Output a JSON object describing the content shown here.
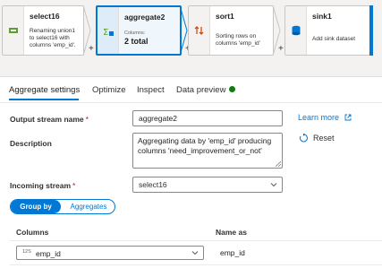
{
  "pipeline": {
    "nodes": [
      {
        "title": "select16",
        "description": "Renaming union1 to select16 with columns 'emp_id'."
      },
      {
        "title": "aggregate2",
        "sub_label": "Columns:",
        "big_value": "2 total"
      },
      {
        "title": "sort1",
        "description": "Sorting rows on columns 'emp_id'"
      },
      {
        "title": "sink1",
        "description": "Add sink dataset"
      }
    ],
    "add_symbol": "+"
  },
  "tabs": [
    "Aggregate settings",
    "Optimize",
    "Inspect",
    "Data preview"
  ],
  "active_tab": "Aggregate settings",
  "form": {
    "output_stream": {
      "label": "Output stream name",
      "required_mark": "*",
      "value": "aggregate2"
    },
    "description": {
      "label": "Description",
      "value": "Aggregating data by 'emp_id' producing columns 'need_improvement_or_not'"
    },
    "incoming_stream": {
      "label": "Incoming stream",
      "required_mark": "*",
      "value": "select16"
    },
    "learn_more": "Learn more",
    "reset": "Reset"
  },
  "toggle": {
    "group_by": "Group by",
    "aggregates": "Aggregates"
  },
  "columns_table": {
    "headers": {
      "columns": "Columns",
      "name_as": "Name as"
    },
    "rows": [
      {
        "type_tag": "12S",
        "column": "emp_id",
        "name_as": "emp_id"
      }
    ]
  },
  "colors": {
    "accent": "#0078d4",
    "success": "#107c10",
    "required": "#a4262c"
  },
  "icons": [
    "select-icon",
    "aggregate-icon",
    "sort-icon",
    "sink-icon",
    "external-link-icon",
    "reset-icon",
    "chevron-down-icon"
  ]
}
